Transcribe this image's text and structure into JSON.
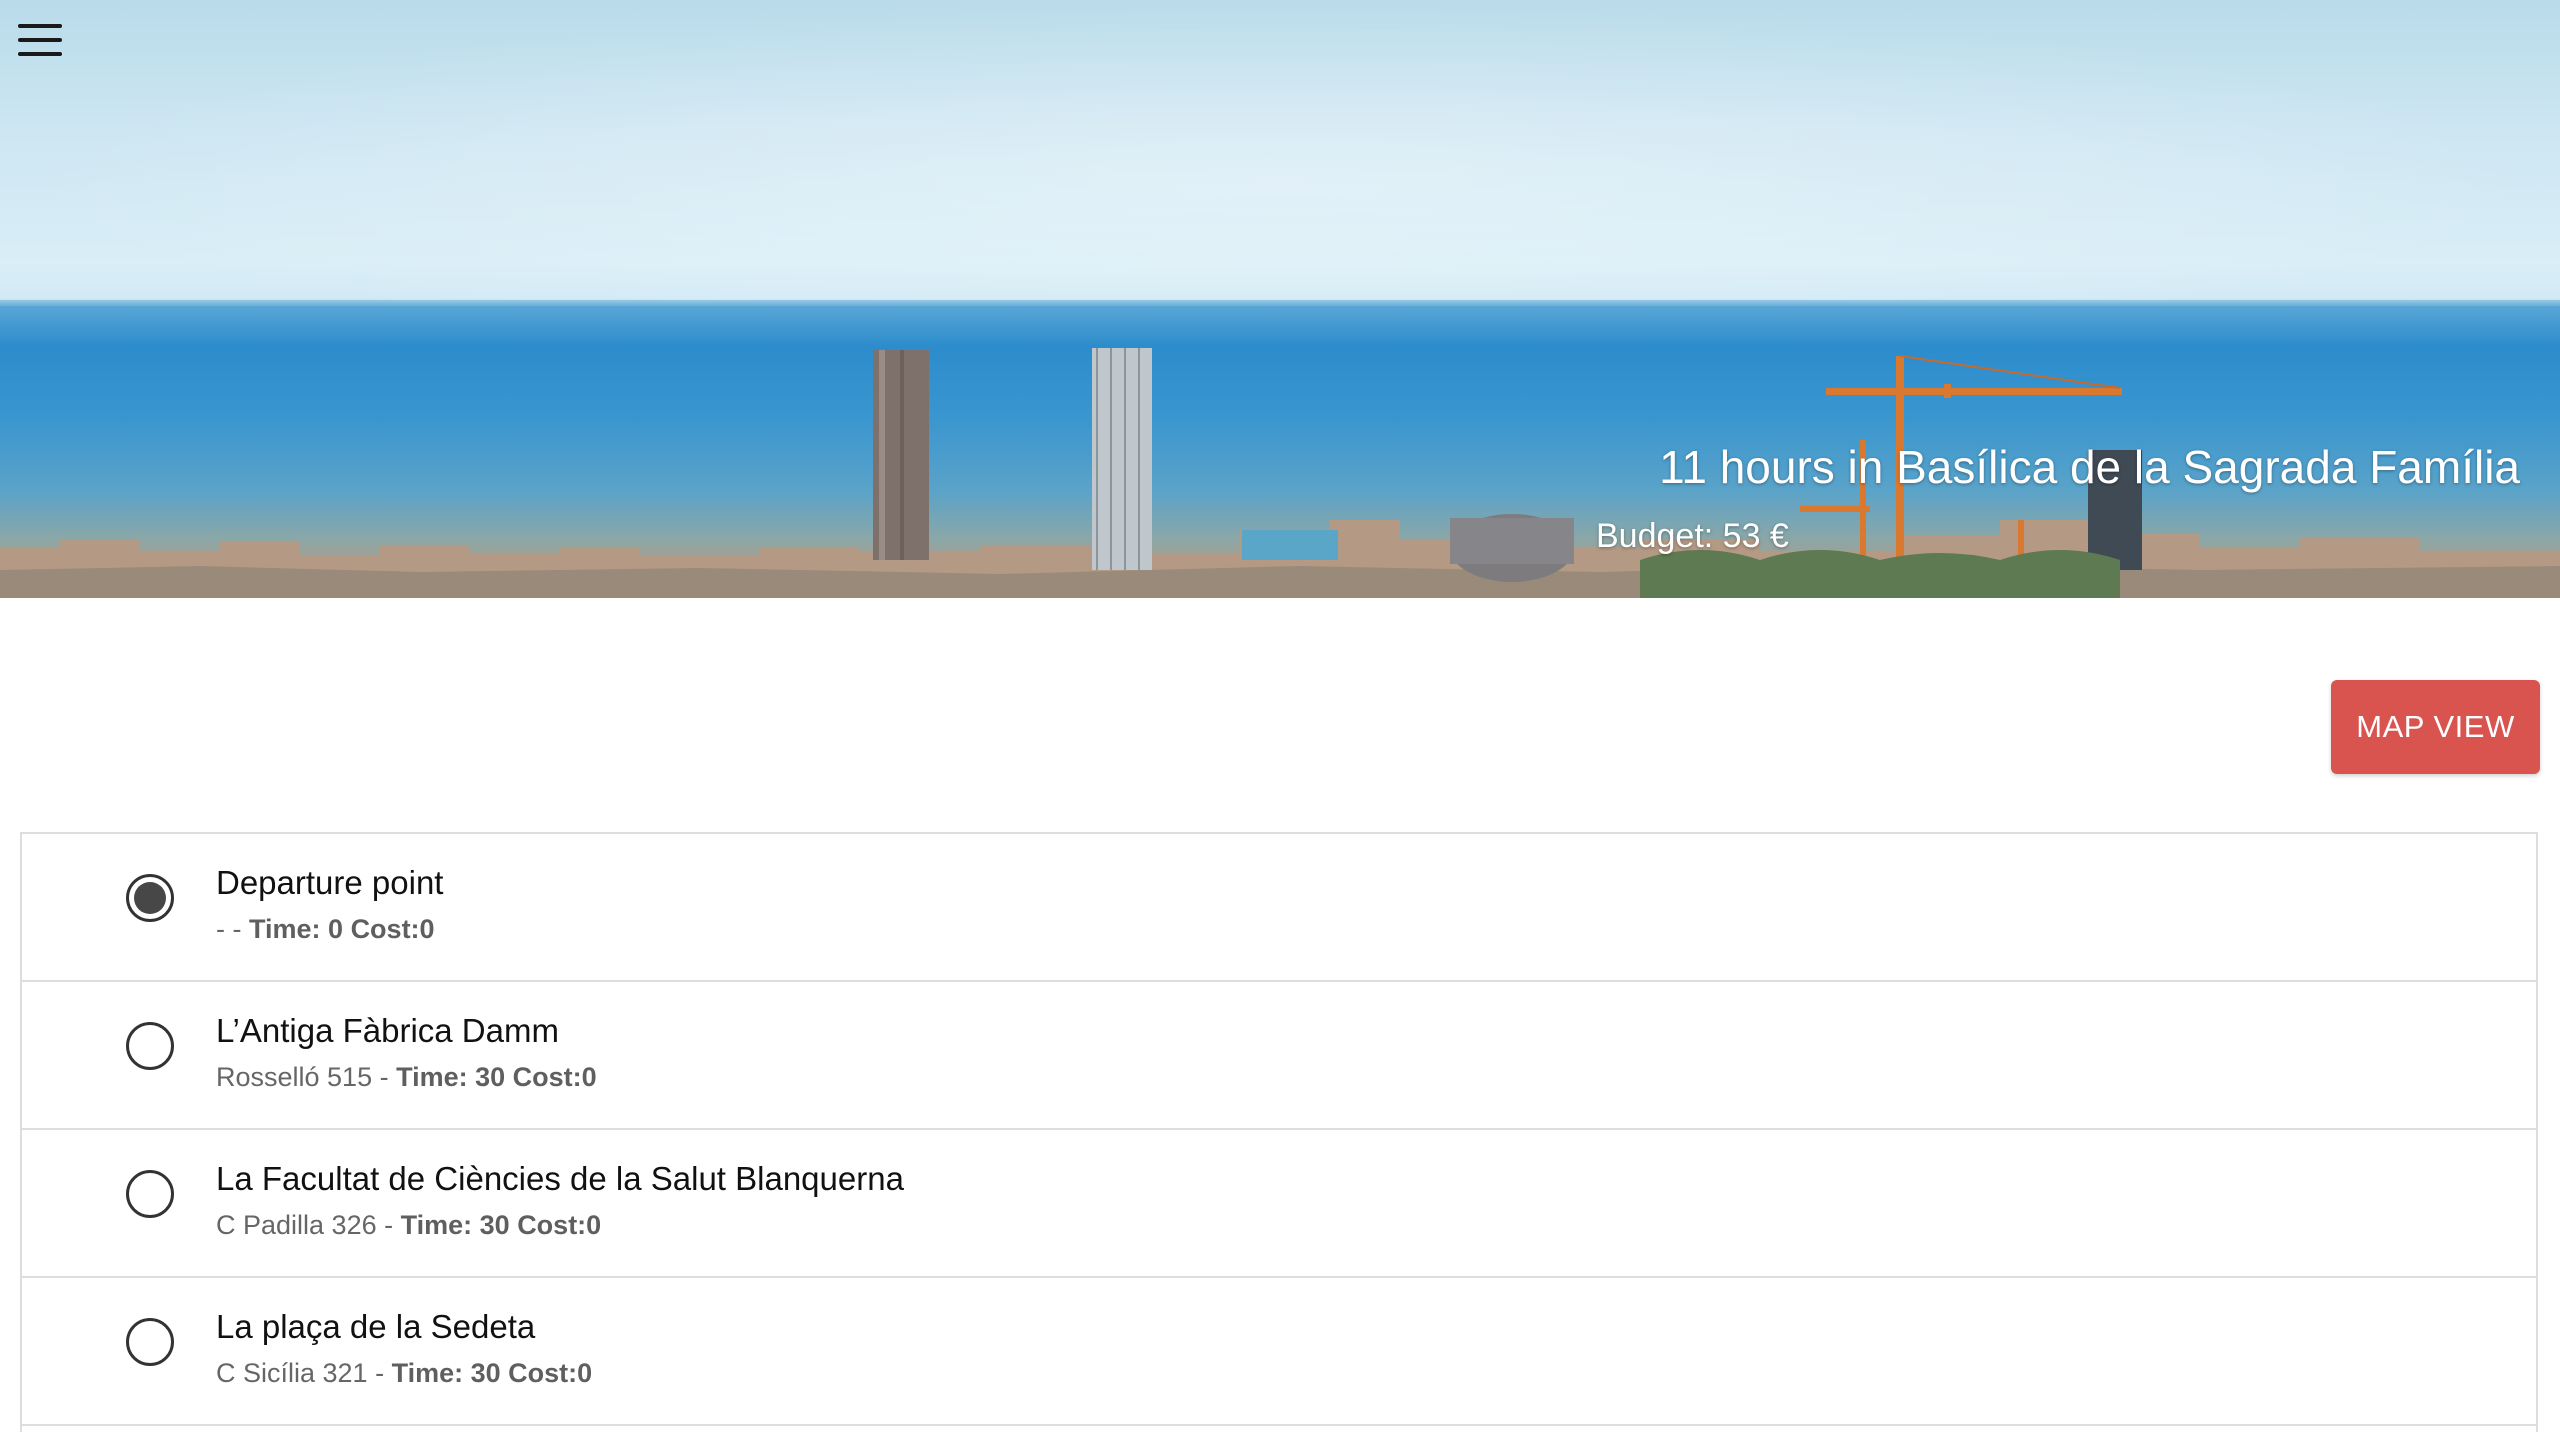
{
  "header": {
    "menu_icon": "hamburger-menu-icon",
    "title": "11 hours in Basílica de la Sagrada Família",
    "budget": "Budget: 53 €"
  },
  "actions": {
    "map_view_label": "MAP VIEW",
    "accent_color": "#d9534f"
  },
  "stops": [
    {
      "name": "Departure point",
      "address": "-",
      "separator": " - ",
      "time_label": "Time: 0",
      "cost_label": "Cost:0",
      "selected": true
    },
    {
      "name": "L’Antiga Fàbrica Damm",
      "address": "Rosselló 515",
      "separator": " - ",
      "time_label": "Time: 30",
      "cost_label": "Cost:0",
      "selected": false
    },
    {
      "name": "La Facultat de Ciències de la Salut Blanquerna",
      "address": "C Padilla 326",
      "separator": " - ",
      "time_label": "Time: 30",
      "cost_label": "Cost:0",
      "selected": false
    },
    {
      "name": "La plaça de la Sedeta",
      "address": "C Sicília 321",
      "separator": " - ",
      "time_label": "Time: 30",
      "cost_label": "Cost:0",
      "selected": false
    }
  ]
}
